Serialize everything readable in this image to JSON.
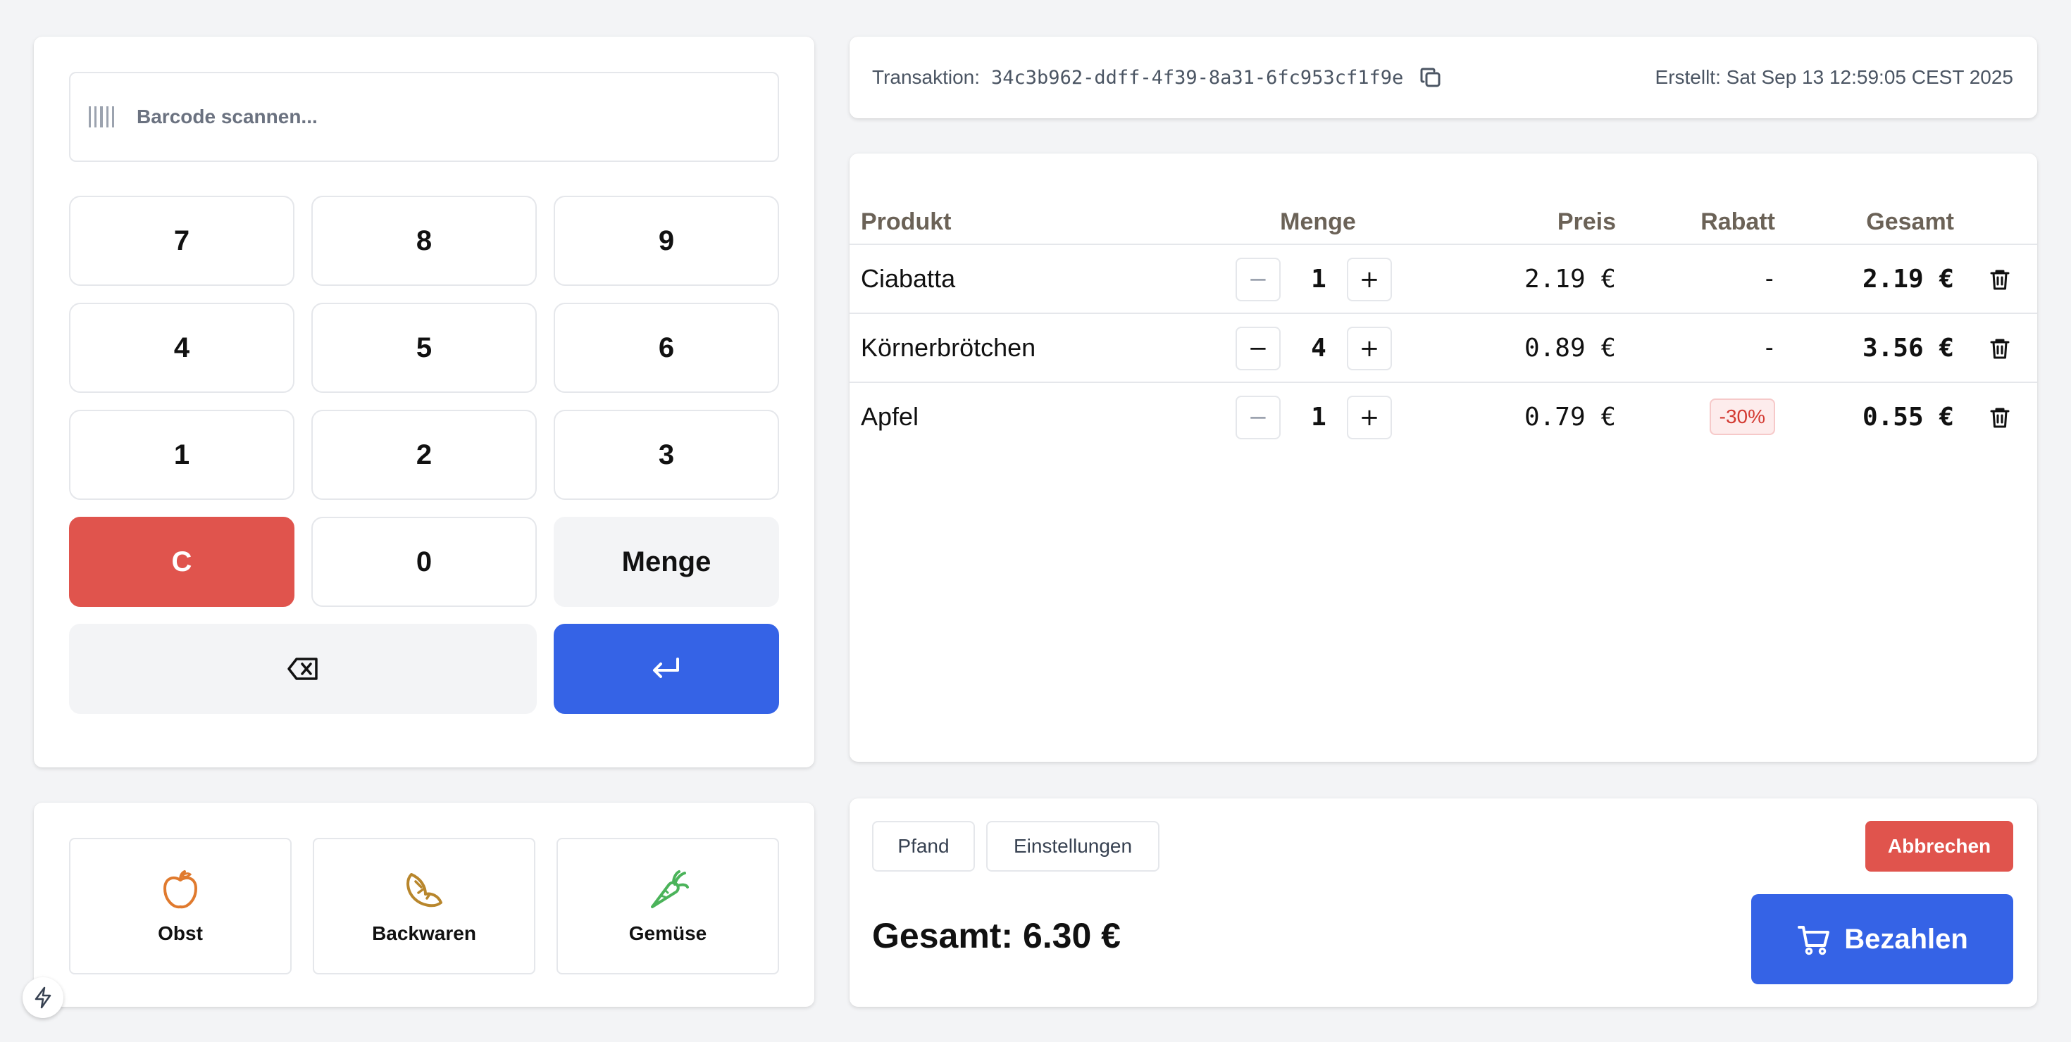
{
  "barcode": {
    "placeholder": "Barcode scannen..."
  },
  "keypad": {
    "keys": [
      "7",
      "8",
      "9",
      "4",
      "5",
      "6",
      "1",
      "2",
      "3",
      "C",
      "0",
      "Menge"
    ],
    "backspace_icon": "backspace-icon",
    "enter_icon": "enter-icon"
  },
  "categories": [
    {
      "label": "Obst",
      "icon": "apple-icon",
      "color": "#e07a2e"
    },
    {
      "label": "Backwaren",
      "icon": "croissant-icon",
      "color": "#b8862c"
    },
    {
      "label": "Gemüse",
      "icon": "carrot-icon",
      "color": "#4bb35a"
    }
  ],
  "transaction": {
    "label": "Transaktion:",
    "id": "34c3b962-ddff-4f39-8a31-6fc953cf1f9e",
    "created": "Erstellt: Sat Sep 13 12:59:05 CEST 2025"
  },
  "cart": {
    "columns": {
      "product": "Produkt",
      "quantity": "Menge",
      "price": "Preis",
      "discount": "Rabatt",
      "total": "Gesamt"
    },
    "items": [
      {
        "name": "Ciabatta",
        "qty": "1",
        "price": "2.19 €",
        "discount": "-",
        "total": "2.19 €"
      },
      {
        "name": "Körnerbrötchen",
        "qty": "4",
        "price": "0.89 €",
        "discount": "-",
        "total": "3.56 €"
      },
      {
        "name": "Apfel",
        "qty": "1",
        "price": "0.79 €",
        "discount": "-30%",
        "total": "0.55 €"
      }
    ]
  },
  "footer": {
    "pfand": "Pfand",
    "settings": "Einstellungen",
    "cancel": "Abbrechen",
    "grand_total": "Gesamt: 6.30 €",
    "pay": "Bezahlen"
  },
  "colors": {
    "accent_blue": "#3563e6",
    "danger_red": "#e0544d",
    "discount_red": "#d33a32"
  }
}
